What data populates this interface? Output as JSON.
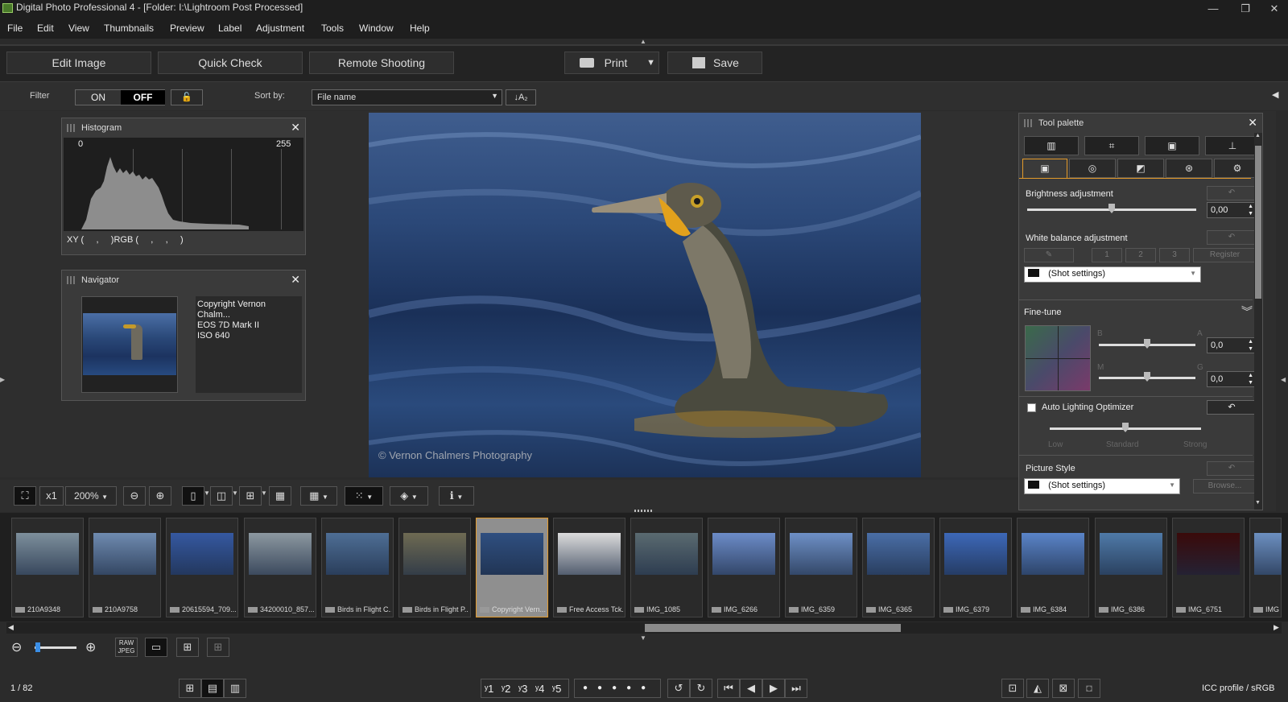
{
  "window": {
    "title": "Digital Photo Professional 4 - [Folder: I:\\Lightroom Post Processed]"
  },
  "menu": [
    "File",
    "Edit",
    "View",
    "Thumbnails",
    "Preview",
    "Label",
    "Adjustment",
    "Tools",
    "Window",
    "Help"
  ],
  "toolbar": {
    "edit_image": "Edit Image",
    "quick_check": "Quick Check",
    "remote_shooting": "Remote Shooting",
    "print": "Print",
    "save": "Save"
  },
  "filterbar": {
    "filter_label": "Filter",
    "on": "ON",
    "off": "OFF",
    "sort_label": "Sort by:",
    "sort_value": "File name",
    "sort_dir": "↓A₂"
  },
  "histogram": {
    "title": "Histogram",
    "min": "0",
    "max": "255",
    "readout": "XY (     ,     )RGB (     ,     ,     )"
  },
  "navigator": {
    "title": "Navigator",
    "info": [
      "Copyright Vernon Chalm...",
      "EOS 7D Mark II",
      "ISO 640"
    ]
  },
  "photo": {
    "watermark": "© Vernon Chalmers Photography"
  },
  "viewbar": {
    "zoom_mode": "x1",
    "zoom_level": "200%"
  },
  "toolpalette": {
    "title": "Tool palette",
    "brightness_label": "Brightness adjustment",
    "brightness_value": "0,00",
    "brightness_level": 0.5,
    "wb_label": "White balance adjustment",
    "wb_buttons": [
      "1",
      "2",
      "3"
    ],
    "wb_register": "Register",
    "wb_preset": "(Shot settings)",
    "finetune_label": "Fine-tune",
    "ft_b": "B",
    "ft_a": "A",
    "ft_m": "M",
    "ft_g": "G",
    "ft_ba_value": "0,0",
    "ft_mg_value": "0,0",
    "alo_label": "Auto Lighting Optimizer",
    "alo_low": "Low",
    "alo_standard": "Standard",
    "alo_strong": "Strong",
    "ps_label": "Picture Style",
    "ps_value": "(Shot settings)",
    "ps_browse": "Browse..."
  },
  "thumbnails": [
    {
      "label": "210A9348",
      "color": "#7d8f9c"
    },
    {
      "label": "210A9758",
      "color": "#6f8bb0"
    },
    {
      "label": "20615594_709...",
      "color": "#3558a0"
    },
    {
      "label": "34200010_857...",
      "color": "#8c98a0"
    },
    {
      "label": "Birds in Flight C...",
      "color": "#4e6e95"
    },
    {
      "label": "Birds in Flight P...",
      "color": "#6e6a52"
    },
    {
      "label": "Copyright Vern...",
      "color": "#2f4f80"
    },
    {
      "label": "Free Access Tck...",
      "color": "#dcdcdc"
    },
    {
      "label": "IMG_1085",
      "color": "#5a6a70"
    },
    {
      "label": "IMG_6266",
      "color": "#6c8cc8"
    },
    {
      "label": "IMG_6359",
      "color": "#6e90c6"
    },
    {
      "label": "IMG_6365",
      "color": "#4a6ea6"
    },
    {
      "label": "IMG_6379",
      "color": "#3d68b8"
    },
    {
      "label": "IMG_6384",
      "color": "#5a84c8"
    },
    {
      "label": "IMG_6386",
      "color": "#4f7aa8"
    },
    {
      "label": "IMG_6751",
      "color": "#3a0a0a"
    },
    {
      "label": "IMG",
      "color": "#6c8fc0"
    }
  ],
  "status": {
    "count": "1 / 82",
    "icc": "ICC profile / sRGB",
    "ratings": [
      "ʸ1",
      "ʸ2",
      "ʸ3",
      "ʸ4",
      "ʸ5"
    ]
  },
  "bottombar": {
    "raw_jpeg": "RAW JPEG"
  }
}
